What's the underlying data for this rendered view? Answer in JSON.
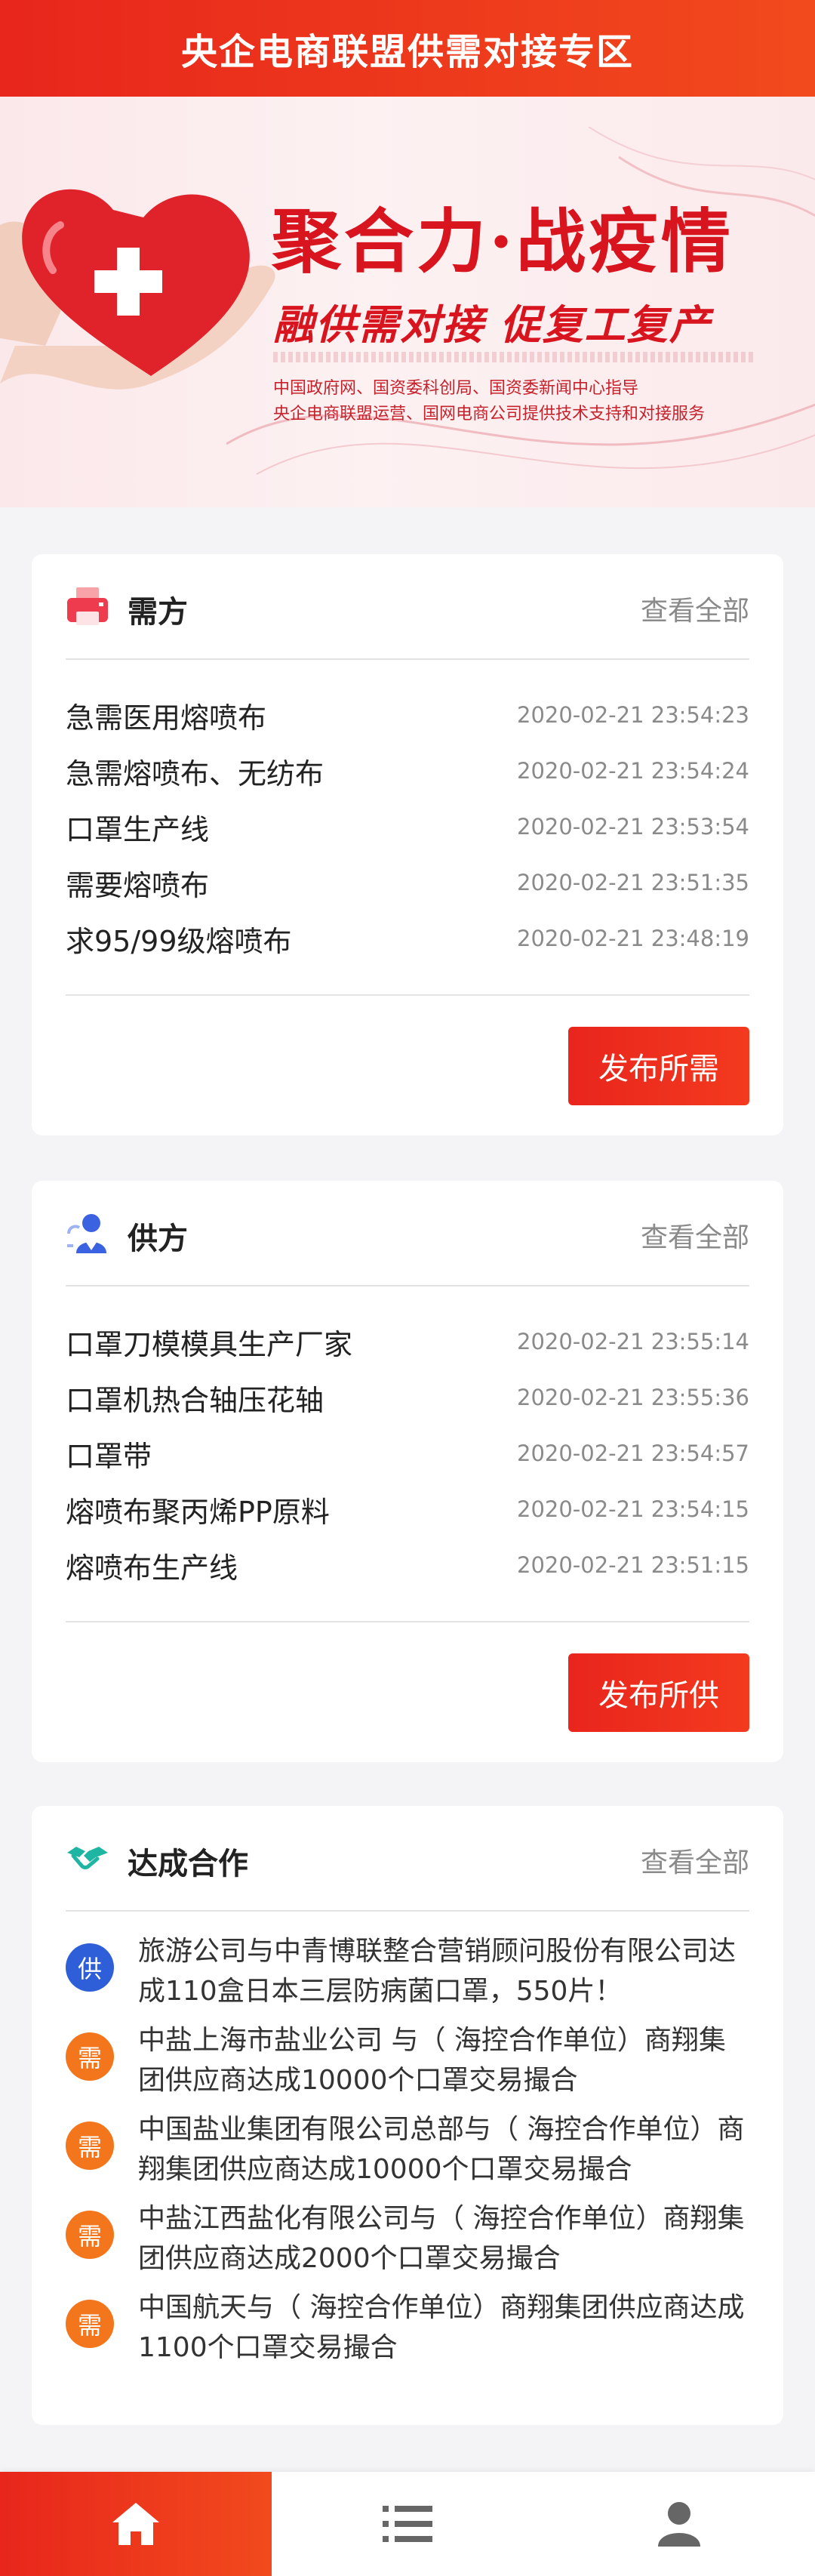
{
  "header": {
    "title": "央企电商联盟供需对接专区"
  },
  "banner": {
    "title": "聚合力·战疫情",
    "subtitle": "融供需对接  促复工复产",
    "line1": "中国政府网、国资委科创局、国资委新闻中心指导",
    "line2": "央企电商联盟运营、国网电商公司提供技术支持和对接服务"
  },
  "demand": {
    "title": "需方",
    "view_all": "查看全部",
    "button": "发布所需",
    "items": [
      {
        "title": "急需医用熔喷布",
        "date": "2020-02-21 23:54:23"
      },
      {
        "title": "急需熔喷布、无纺布",
        "date": "2020-02-21 23:54:24"
      },
      {
        "title": "口罩生产线",
        "date": "2020-02-21 23:53:54"
      },
      {
        "title": "需要熔喷布",
        "date": "2020-02-21 23:51:35"
      },
      {
        "title": "求95/99级熔喷布",
        "date": "2020-02-21 23:48:19"
      }
    ]
  },
  "supply": {
    "title": "供方",
    "view_all": "查看全部",
    "button": "发布所供",
    "items": [
      {
        "title": "口罩刀模模具生产厂家",
        "date": "2020-02-21 23:55:14"
      },
      {
        "title": "口罩机热合轴压花轴",
        "date": "2020-02-21 23:55:36"
      },
      {
        "title": "口罩带",
        "date": "2020-02-21 23:54:57"
      },
      {
        "title": "熔喷布聚丙烯PP原料",
        "date": "2020-02-21 23:54:15"
      },
      {
        "title": "熔喷布生产线",
        "date": "2020-02-21 23:51:15"
      }
    ]
  },
  "deals": {
    "title": "达成合作",
    "view_all": "查看全部",
    "items": [
      {
        "badge": "供",
        "type": "supply",
        "text": "旅游公司与中青博联整合营销顾问股份有限公司达成110盒日本三层防病菌口罩，550片！"
      },
      {
        "badge": "需",
        "type": "demand",
        "text": "中盐上海市盐业公司 与（ 海控合作单位）商翔集团供应商达成10000个口罩交易撮合"
      },
      {
        "badge": "需",
        "type": "demand",
        "text": "中国盐业集团有限公司总部与（ 海控合作单位）商翔集团供应商达成10000个口罩交易撮合"
      },
      {
        "badge": "需",
        "type": "demand",
        "text": "中盐江西盐化有限公司与（ 海控合作单位）商翔集团供应商达成2000个口罩交易撮合"
      },
      {
        "badge": "需",
        "type": "demand",
        "text": "中国航天与（ 海控合作单位）商翔集团供应商达成1100个口罩交易撮合"
      }
    ]
  },
  "tabbar": {
    "icons": [
      "home-icon",
      "list-icon",
      "user-icon"
    ],
    "active_color": "#e8261c"
  }
}
